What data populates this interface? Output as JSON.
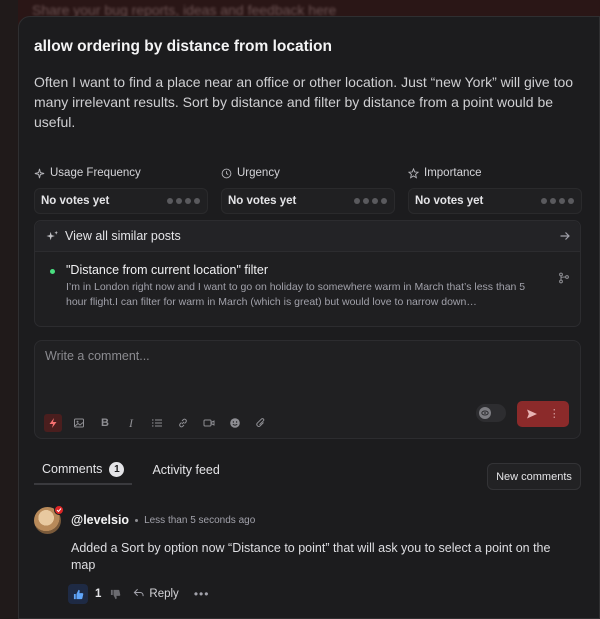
{
  "backdrop": {
    "text": "Share your bug reports, ideas and feedback here"
  },
  "post": {
    "title": "allow ordering by distance from location",
    "description": "Often I want to find a place near an office or other location. Just “new York” will give too many irrelevant results. Sort by distance and filter by distance from a point would be useful."
  },
  "metrics": [
    {
      "label": "Usage Frequency",
      "value": "No votes yet",
      "icon": "sparkle-icon"
    },
    {
      "label": "Urgency",
      "value": "No votes yet",
      "icon": "clock-icon"
    },
    {
      "label": "Importance",
      "value": "No votes yet",
      "icon": "star-icon"
    }
  ],
  "similar": {
    "header": "View all similar posts",
    "item": {
      "title": "\"Distance from current location\" filter",
      "text": "I’m in London right now and I want to go on holiday to somewhere warm in March that’s less than 5 hour flight.I can filter for warm in March (which is great) but would love to narrow down…"
    }
  },
  "composer": {
    "placeholder": "Write a comment..."
  },
  "tabs": {
    "comments_label": "Comments",
    "comments_count": "1",
    "activity_label": "Activity feed",
    "new_comments_label": "New comments"
  },
  "comment": {
    "author": "@levelsio",
    "time": "Less than 5 seconds ago",
    "body": "Added a Sort by option now “Distance to point” that will ask you to select a point on the map",
    "likes": "1",
    "reply_label": "Reply",
    "more_label": "•••"
  },
  "colors": {
    "accent": "#8b2a2a",
    "panel": "#1c1c1e",
    "like": "#60a5fa",
    "status_dot": "#4ade80"
  }
}
